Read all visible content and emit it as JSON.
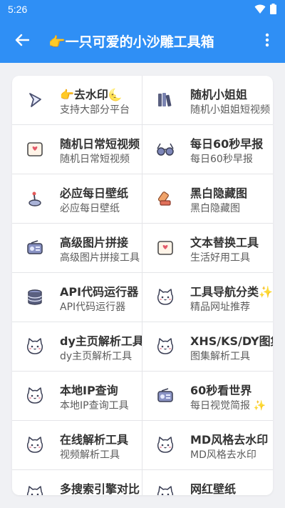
{
  "status": {
    "time": "5:26"
  },
  "appbar": {
    "title": "👉一只可爱的小沙雕工具箱"
  },
  "colors": {
    "primary": "#2f8ff5",
    "background": "#f0f1f4",
    "card": "#ffffff",
    "divider": "#e4e5e8"
  },
  "tools": [
    {
      "title": "👉去水印🌜",
      "subtitle": "支持大部分平台",
      "icon": "play-arrow-icon"
    },
    {
      "title": "随机小姐姐",
      "subtitle": "随机小姐姐短视频",
      "icon": "books-icon"
    },
    {
      "title": "随机日常短视频",
      "subtitle": "随机日常短视频",
      "icon": "love-letter-icon"
    },
    {
      "title": "每日60秒早报",
      "subtitle": "每日60秒早报",
      "icon": "glasses-icon"
    },
    {
      "title": "必应每日壁纸",
      "subtitle": "必应每日壁纸",
      "icon": "joystick-icon"
    },
    {
      "title": "黑白隐藏图",
      "subtitle": "黑白隐藏图",
      "icon": "stamp-icon"
    },
    {
      "title": "高级图片拼接",
      "subtitle": "高级图片拼接工具",
      "icon": "radio-icon"
    },
    {
      "title": "文本替换工具",
      "subtitle": "生活好用工具",
      "icon": "love-letter-icon"
    },
    {
      "title": "API代码运行器",
      "subtitle": "API代码运行器",
      "icon": "database-icon"
    },
    {
      "title": "工具导航分类✨",
      "subtitle": "精品网址推荐",
      "icon": "cat-face-icon"
    },
    {
      "title": "dy主页解析工具",
      "subtitle": "dy主页解析工具",
      "icon": "cat-face-icon"
    },
    {
      "title": "XHS/KS/DY图集",
      "subtitle": "图集解析工具",
      "icon": "cat-face-icon"
    },
    {
      "title": "本地IP查询",
      "subtitle": "本地IP查询工具",
      "icon": "cat-face-icon"
    },
    {
      "title": "60秒看世界",
      "subtitle": "每日视觉简报 ✨",
      "icon": "radio-icon"
    },
    {
      "title": "在线解析工具",
      "subtitle": "视频解析工具",
      "icon": "cat-face-icon"
    },
    {
      "title": "MD风格去水印",
      "subtitle": "MD风格去水印",
      "icon": "cat-face-icon"
    },
    {
      "title": "多搜索引擎对比",
      "subtitle": "",
      "icon": "cat-face-icon"
    },
    {
      "title": "网红壁纸",
      "subtitle": "",
      "icon": "cat-face-icon"
    }
  ]
}
